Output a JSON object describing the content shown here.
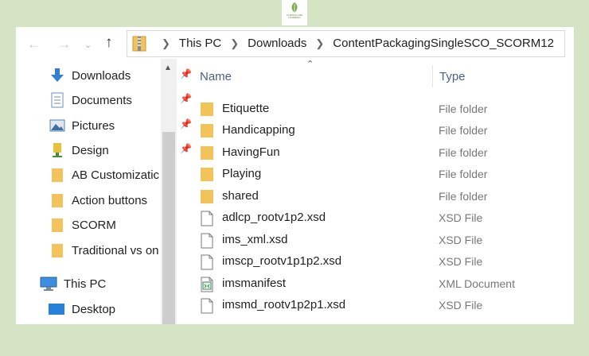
{
  "breadcrumb": [
    "This PC",
    "Downloads",
    "ContentPackagingSingleSCO_SCORM12"
  ],
  "columns": {
    "name": "Name",
    "type": "Type"
  },
  "sidebar": [
    {
      "label": "Downloads",
      "icon": "download-arrow-icon",
      "pinned": true
    },
    {
      "label": "Documents",
      "icon": "documents-icon",
      "pinned": true
    },
    {
      "label": "Pictures",
      "icon": "pictures-icon",
      "pinned": true
    },
    {
      "label": "Design",
      "icon": "usb-drive-icon",
      "pinned": true
    },
    {
      "label": "AB Customizatic",
      "icon": "folder-icon",
      "pinned": false
    },
    {
      "label": "Action buttons",
      "icon": "folder-icon",
      "pinned": false
    },
    {
      "label": "SCORM",
      "icon": "folder-icon",
      "pinned": false
    },
    {
      "label": "Traditional vs on",
      "icon": "folder-icon",
      "pinned": false
    },
    {
      "label": "This PC",
      "icon": "computer-icon",
      "pinned": false
    },
    {
      "label": "Desktop",
      "icon": "desktop-icon",
      "pinned": false
    }
  ],
  "files": [
    {
      "name": "Etiquette",
      "type": "File folder",
      "icon": "folder-icon"
    },
    {
      "name": "Handicapping",
      "type": "File folder",
      "icon": "folder-icon"
    },
    {
      "name": "HavingFun",
      "type": "File folder",
      "icon": "folder-icon"
    },
    {
      "name": "Playing",
      "type": "File folder",
      "icon": "folder-icon"
    },
    {
      "name": "shared",
      "type": "File folder",
      "icon": "folder-icon"
    },
    {
      "name": "adlcp_rootv1p2.xsd",
      "type": "XSD File",
      "icon": "file-icon"
    },
    {
      "name": "ims_xml.xsd",
      "type": "XSD File",
      "icon": "file-icon"
    },
    {
      "name": "imscp_rootv1p1p2.xsd",
      "type": "XSD File",
      "icon": "file-icon"
    },
    {
      "name": "imsmanifest",
      "type": "XML Document",
      "icon": "xml-file-icon"
    },
    {
      "name": "imsmd_rootv1p2p1.xsd",
      "type": "XSD File",
      "icon": "file-icon"
    }
  ],
  "colors": {
    "background": "#d5e4c4",
    "folder": "#f2c35a",
    "header_text": "#4d6082"
  },
  "logo_text": "SCIENCE AND LEARNING"
}
